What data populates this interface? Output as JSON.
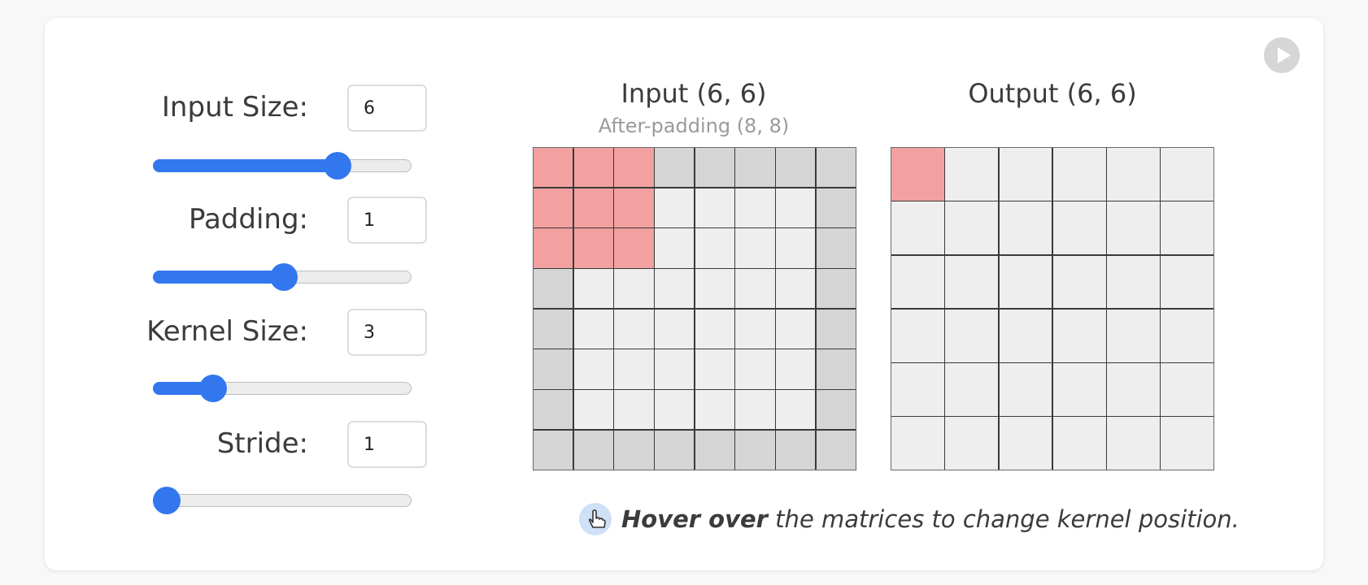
{
  "controls": [
    {
      "label": "Input Size:",
      "value": "6",
      "slider_fraction": 0.73
    },
    {
      "label": "Padding:",
      "value": "1",
      "slider_fraction": 0.5
    },
    {
      "label": "Kernel Size:",
      "value": "3",
      "slider_fraction": 0.2
    },
    {
      "label": "Stride:",
      "value": "1",
      "slider_fraction": 0.0
    }
  ],
  "input_grid": {
    "title": "Input (6, 6)",
    "subtitle": "After-padding (8, 8)",
    "size": 8,
    "padding": 1,
    "kernel_row": 0,
    "kernel_col": 0,
    "kernel_size": 3
  },
  "output_grid": {
    "title": "Output (6, 6)",
    "size": 6,
    "highlight_row": 0,
    "highlight_col": 0
  },
  "hint": {
    "bold": "Hover over",
    "rest": " the matrices to change kernel position."
  },
  "colors": {
    "accent": "#3377ee",
    "kernel_highlight": "#f2a0a0",
    "padding_cell": "#d5d5d5",
    "cell": "#eeeeee"
  }
}
